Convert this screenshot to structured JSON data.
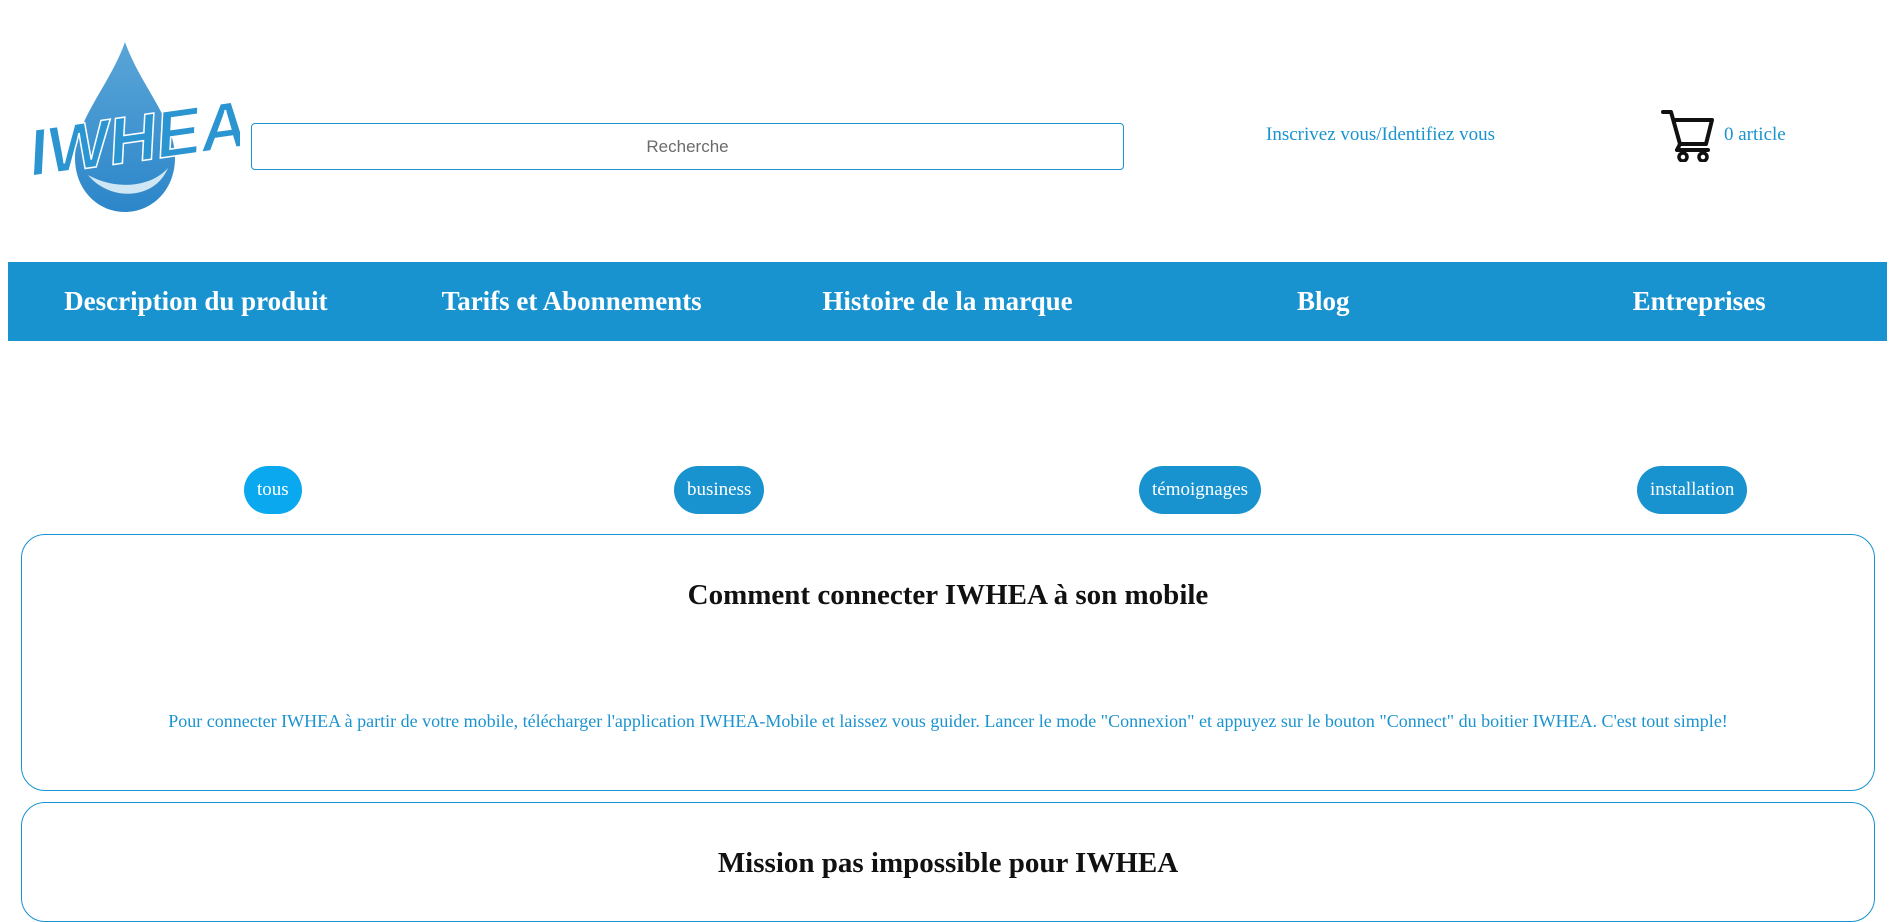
{
  "brand": {
    "logo_text": "IWHEA"
  },
  "search": {
    "placeholder": "Recherche"
  },
  "account": {
    "login_label": "Inscrivez vous/Identifiez vous"
  },
  "cart": {
    "icon": "shopping-cart-icon",
    "count_label": "0 article"
  },
  "nav": {
    "items": [
      {
        "label": "Description du produit"
      },
      {
        "label": "Tarifs et Abonnements"
      },
      {
        "label": "Histoire de la marque"
      },
      {
        "label": "Blog"
      },
      {
        "label": "Entreprises"
      }
    ]
  },
  "filters": {
    "items": [
      {
        "label": "tous",
        "active": true
      },
      {
        "label": "business",
        "active": false
      },
      {
        "label": "témoignages",
        "active": false
      },
      {
        "label": "installation",
        "active": false
      }
    ]
  },
  "articles": [
    {
      "title": "Comment connecter IWHEA à son mobile",
      "body": "Pour connecter IWHEA à partir de votre mobile, télécharger l'application IWHEA-Mobile et laissez vous guider. Lancer le mode \"Connexion\" et appuyez sur le bouton \"Connect\" du boitier IWHEA. C'est tout simple!"
    },
    {
      "title": "Mission pas impossible pour IWHEA",
      "body": ""
    }
  ],
  "colors": {
    "primary": "#1893cf",
    "active_filter": "#0aa9ef",
    "link": "#1a93cf"
  }
}
